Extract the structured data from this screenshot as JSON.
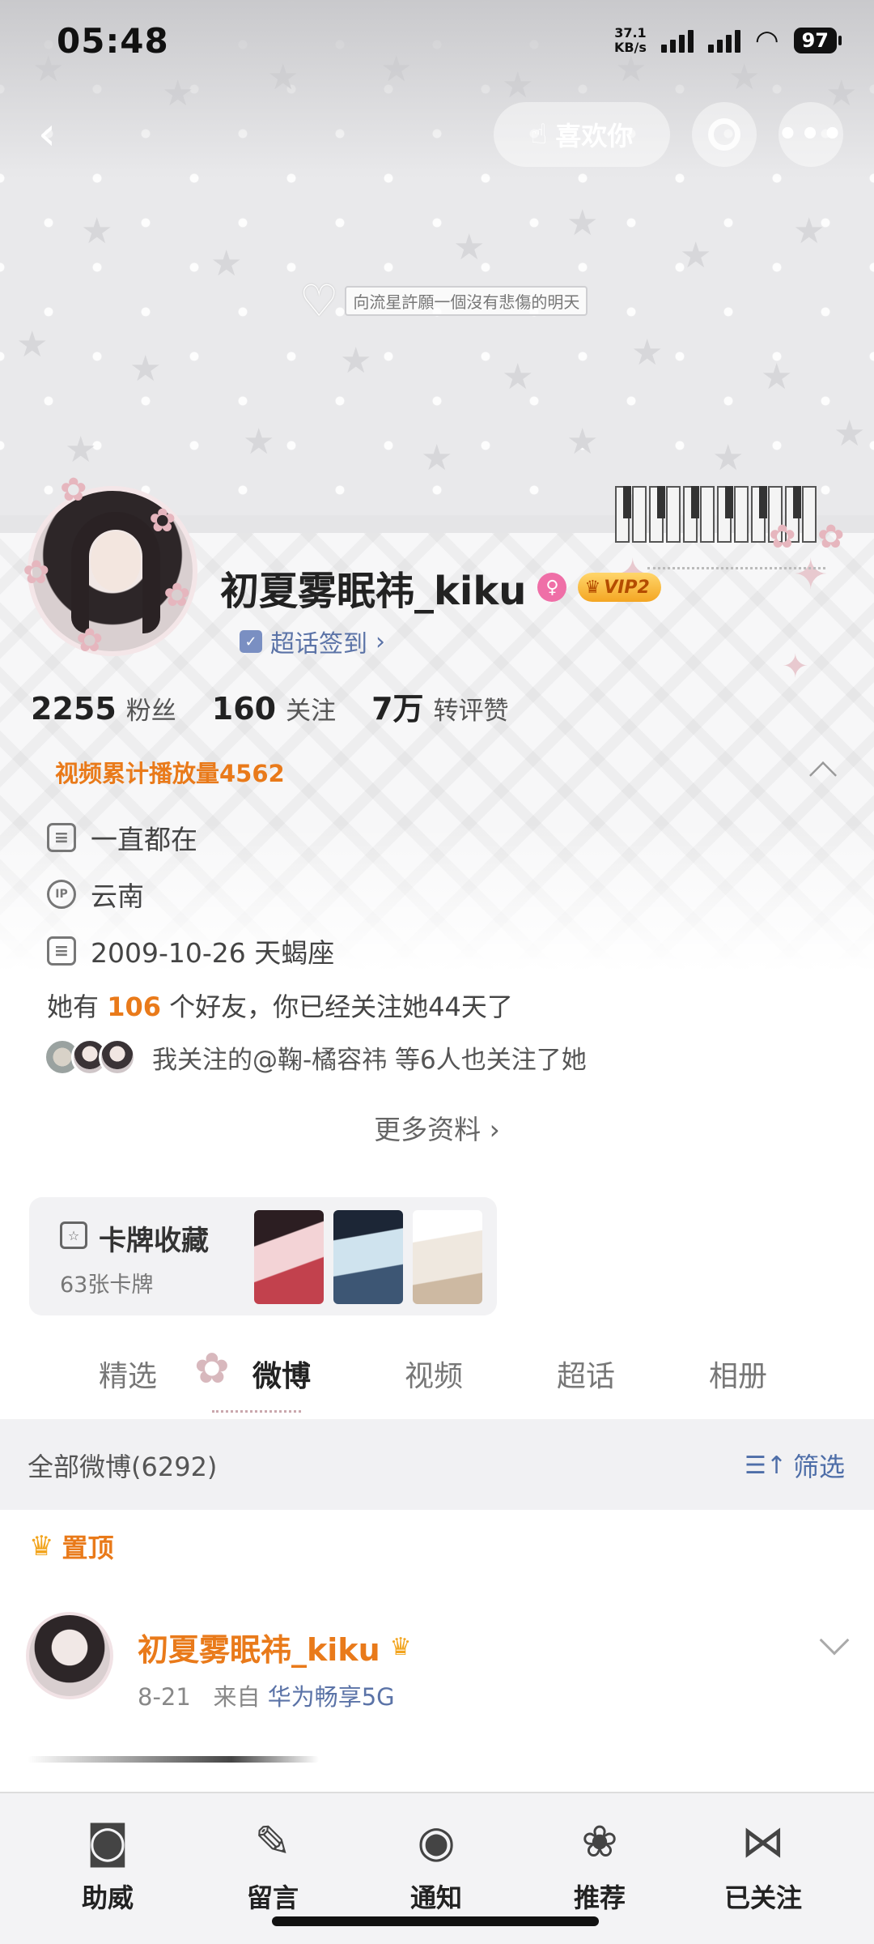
{
  "status_bar": {
    "time": "05:48",
    "net_speed_value": "37.1",
    "net_speed_unit": "KB/s",
    "battery": "97"
  },
  "top_nav": {
    "like_button_label": "喜欢你",
    "icons": [
      "back-chevron",
      "hand-heart",
      "ring",
      "more-dots"
    ]
  },
  "banner": {
    "quote": "向流星許願一個沒有悲傷的明天"
  },
  "profile": {
    "username": "初夏雾眠祎_kiku",
    "gender_badge": "♀",
    "vip_label": "VIP2",
    "super_topic_checkin": "超话签到",
    "stats": [
      {
        "value": "2255",
        "label": "粉丝"
      },
      {
        "value": "160",
        "label": "关注"
      },
      {
        "value": "7万",
        "label": "转评赞"
      }
    ],
    "video_plays": "视频累计播放量4562",
    "bio": "一直都在",
    "ip_location": "云南",
    "ip_label": "IP",
    "birthday": "2009-10-26 天蝎座",
    "friends_prefix": "她有",
    "friends_count": "106",
    "friends_suffix": "个好友，你已经关注她44天了",
    "mutual_follow_text": "我关注的@鞠-橘容祎 等6人也关注了她",
    "more_info": "更多资料 ›"
  },
  "card_collection": {
    "title": "卡牌收藏",
    "count": "63张卡牌"
  },
  "tabs": [
    {
      "label": "精选",
      "active": false
    },
    {
      "label": "微博",
      "active": true
    },
    {
      "label": "视频",
      "active": false
    },
    {
      "label": "超话",
      "active": false
    },
    {
      "label": "相册",
      "active": false
    }
  ],
  "feed": {
    "all_posts": "全部微博(6292)",
    "filter_label": "筛选",
    "pinned_label": "置顶"
  },
  "post": {
    "author": "初夏雾眠祎_kiku",
    "date": "8-21",
    "from_label": "来自",
    "source": "华为畅享5G"
  },
  "bottom_bar": [
    {
      "label": "助威",
      "icon": "speaker-icon"
    },
    {
      "label": "留言",
      "icon": "microphone-icon"
    },
    {
      "label": "通知",
      "icon": "record-player-icon"
    },
    {
      "label": "推荐",
      "icon": "roses-icon"
    },
    {
      "label": "已关注",
      "icon": "bow-icon"
    }
  ],
  "colors": {
    "accent_orange": "#e97a1a",
    "link_blue": "#5b73a7",
    "vip_gold": "#f4a623",
    "female_pink": "#ef6fa7"
  }
}
